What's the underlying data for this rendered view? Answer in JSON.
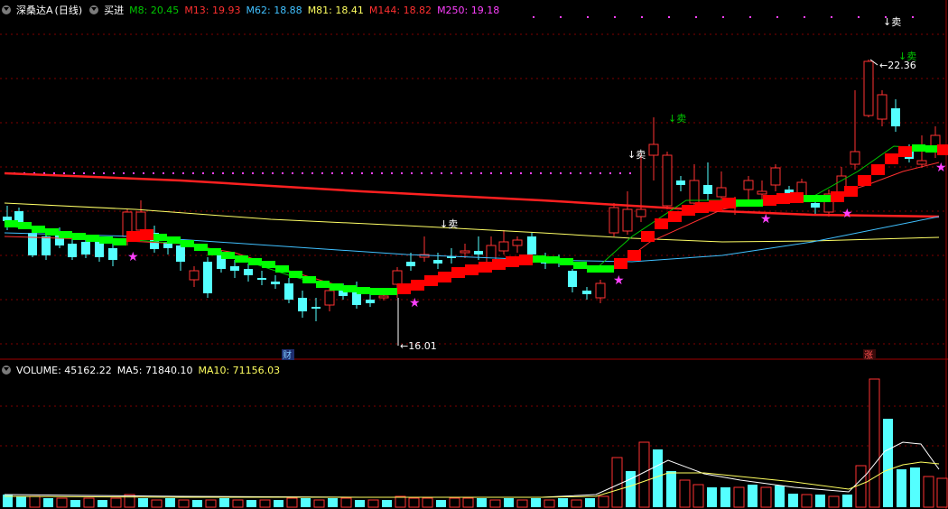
{
  "header": {
    "stock_title": "深桑达A",
    "period": "(日线)",
    "signal_label": "买进",
    "ma_items": [
      {
        "label": "M8: 20.45",
        "color": "#00c800"
      },
      {
        "label": "M13: 19.93",
        "color": "#ff3030"
      },
      {
        "label": "M62: 18.88",
        "color": "#40c0ff"
      },
      {
        "label": "M81: 18.41",
        "color": "#ffff60"
      },
      {
        "label": "M144: 18.82",
        "color": "#ff3030"
      },
      {
        "label": "M250: 19.18",
        "color": "#ff40ff"
      }
    ]
  },
  "volume_legend": {
    "volume": "VOLUME: 45162.22",
    "ma5": "MA5: 71840.10",
    "ma10": "MA10: 71156.03"
  },
  "markers": {
    "low_price": "16.01",
    "high_price": "22.36",
    "sell_label": "↓卖",
    "finance_badge": "财",
    "rise_badge": "涨"
  },
  "colors": {
    "up": "#ff3232",
    "down": "#54ffff",
    "thick_up": "#ff0000",
    "thick_down": "#00ff00",
    "ma_long": "#ff2020",
    "ma_yellow": "#ffff66",
    "ma_cyan": "#40c0ff",
    "star": "#ff40ff"
  }
}
